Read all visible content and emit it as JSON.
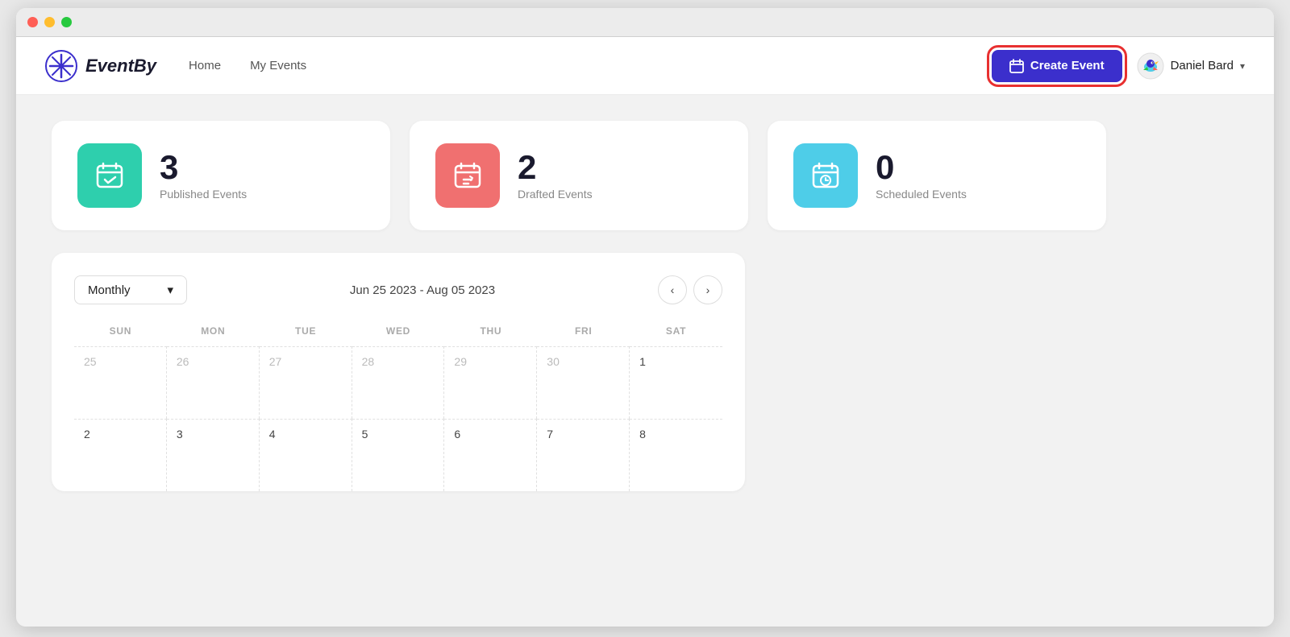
{
  "window": {
    "title": "EventBy"
  },
  "navbar": {
    "logo_text": "EventBy",
    "nav_links": [
      {
        "id": "home",
        "label": "Home"
      },
      {
        "id": "my-events",
        "label": "My Events"
      }
    ],
    "create_event_label": "Create Event",
    "user": {
      "name": "Daniel Bard",
      "chevron": "▾"
    }
  },
  "stats": [
    {
      "id": "published",
      "count": "3",
      "label": "Published Events",
      "color": "teal",
      "icon": "calendar-check"
    },
    {
      "id": "drafted",
      "count": "2",
      "label": "Drafted Events",
      "color": "coral",
      "icon": "calendar-edit"
    },
    {
      "id": "scheduled",
      "count": "0",
      "label": "Scheduled Events",
      "color": "cyan",
      "icon": "calendar-clock"
    }
  ],
  "calendar": {
    "view_label": "Monthly",
    "date_range": "Jun 25 2023 - Aug 05 2023",
    "days_of_week": [
      "SUN",
      "MON",
      "TUE",
      "WED",
      "THU",
      "FRI",
      "SAT"
    ],
    "weeks": [
      [
        {
          "date": "25",
          "current": false
        },
        {
          "date": "26",
          "current": false
        },
        {
          "date": "27",
          "current": false
        },
        {
          "date": "28",
          "current": false
        },
        {
          "date": "29",
          "current": false
        },
        {
          "date": "30",
          "current": false
        },
        {
          "date": "1",
          "current": true
        }
      ],
      [
        {
          "date": "2",
          "current": true
        },
        {
          "date": "3",
          "current": true
        },
        {
          "date": "4",
          "current": true
        },
        {
          "date": "5",
          "current": true
        },
        {
          "date": "6",
          "current": true
        },
        {
          "date": "7",
          "current": true
        },
        {
          "date": "8",
          "current": true
        }
      ]
    ],
    "prev_label": "‹",
    "next_label": "›"
  }
}
